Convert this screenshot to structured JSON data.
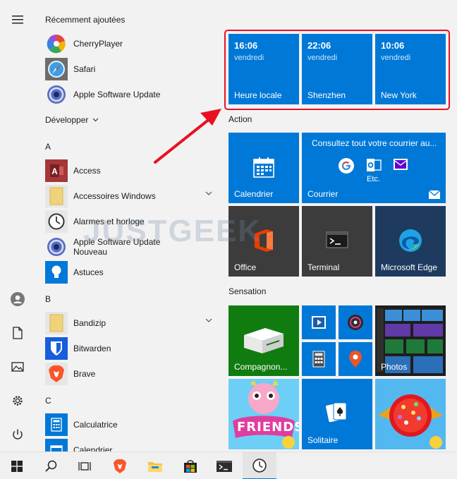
{
  "recent": {
    "header": "Récemment ajoutées",
    "items": [
      {
        "label": "CherryPlayer",
        "icon": "cherryplayer-icon"
      },
      {
        "label": "Safari",
        "icon": "safari-icon"
      },
      {
        "label": "Apple Software Update",
        "icon": "apple-software-update-icon"
      }
    ]
  },
  "expand": {
    "label": "Développer"
  },
  "groups": [
    {
      "letter": "A",
      "items": [
        {
          "label": "Access",
          "icon": "access-icon"
        },
        {
          "label": "Accessoires Windows",
          "icon": "folder-icon"
        },
        {
          "label": "Alarmes et horloge",
          "icon": "alarm-clock-icon"
        },
        {
          "label": "Apple Software Update",
          "sublabel": "Nouveau",
          "icon": "apple-software-update-icon"
        },
        {
          "label": "Astuces",
          "icon": "tips-icon"
        }
      ]
    },
    {
      "letter": "B",
      "items": [
        {
          "label": "Bandizip",
          "icon": "folder-icon"
        },
        {
          "label": "Bitwarden",
          "icon": "bitwarden-icon"
        },
        {
          "label": "Brave",
          "icon": "brave-icon"
        }
      ]
    },
    {
      "letter": "C",
      "items": [
        {
          "label": "Calculatrice",
          "icon": "calculator-icon"
        },
        {
          "label": "Calendrier",
          "icon": "calendar-icon"
        }
      ]
    }
  ],
  "clocks": [
    {
      "time": "16:06",
      "day": "vendredi",
      "label": "Heure locale"
    },
    {
      "time": "22:06",
      "day": "vendredi",
      "label": "Shenzhen"
    },
    {
      "time": "10:06",
      "day": "vendredi",
      "label": "New York"
    }
  ],
  "action": {
    "header": "Action",
    "calendar": "Calendrier",
    "mail_banner": "Consultez tout votre courrier au...",
    "mail_etc": "Etc.",
    "mail": "Courrier",
    "office": "Office",
    "terminal": "Terminal",
    "edge": "Microsoft Edge"
  },
  "sensation": {
    "header": "Sensation",
    "xbox": "Compagnon...",
    "photos": "Photos",
    "solitaire": "Solitaire",
    "friends_text": "FRIENDS"
  },
  "watermark": "JUSTGEEK",
  "colors": {
    "tile_blue": "#0078d7",
    "highlight_red": "#e81123",
    "xbox_green": "#107c10"
  }
}
